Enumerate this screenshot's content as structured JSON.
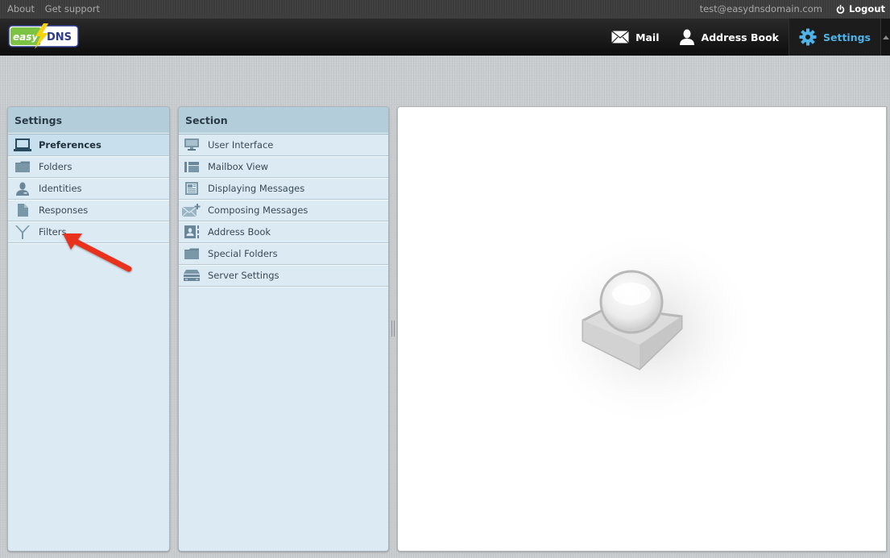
{
  "topbar": {
    "links": [
      "About",
      "Get support"
    ],
    "user_email": "test@easydnsdomain.com",
    "logout_label": "Logout"
  },
  "header": {
    "logo_text_left": "easy",
    "logo_text_right": "DNS",
    "nav": [
      {
        "label": "Mail",
        "icon": "envelope-icon"
      },
      {
        "label": "Address Book",
        "icon": "person-icon"
      },
      {
        "label": "Settings",
        "icon": "gear-icon",
        "active": true
      }
    ],
    "active_color": "#4fb2e8"
  },
  "settings_panel": {
    "title": "Settings",
    "items": [
      {
        "label": "Preferences",
        "icon": "laptop-icon",
        "selected": true
      },
      {
        "label": "Folders",
        "icon": "folder-icon"
      },
      {
        "label": "Identities",
        "icon": "identity-icon"
      },
      {
        "label": "Responses",
        "icon": "document-icon"
      },
      {
        "label": "Filters",
        "icon": "filter-icon"
      }
    ]
  },
  "section_panel": {
    "title": "Section",
    "items": [
      {
        "label": "User Interface",
        "icon": "monitor-icon"
      },
      {
        "label": "Mailbox View",
        "icon": "list-view-icon"
      },
      {
        "label": "Displaying Messages",
        "icon": "message-view-icon"
      },
      {
        "label": "Composing Messages",
        "icon": "compose-icon"
      },
      {
        "label": "Address Book",
        "icon": "contact-card-icon"
      },
      {
        "label": "Special Folders",
        "icon": "folder-icon"
      },
      {
        "label": "Server Settings",
        "icon": "server-icon"
      }
    ]
  },
  "annotation": {
    "arrow_color": "#e8301c",
    "points_to": "Filters"
  }
}
